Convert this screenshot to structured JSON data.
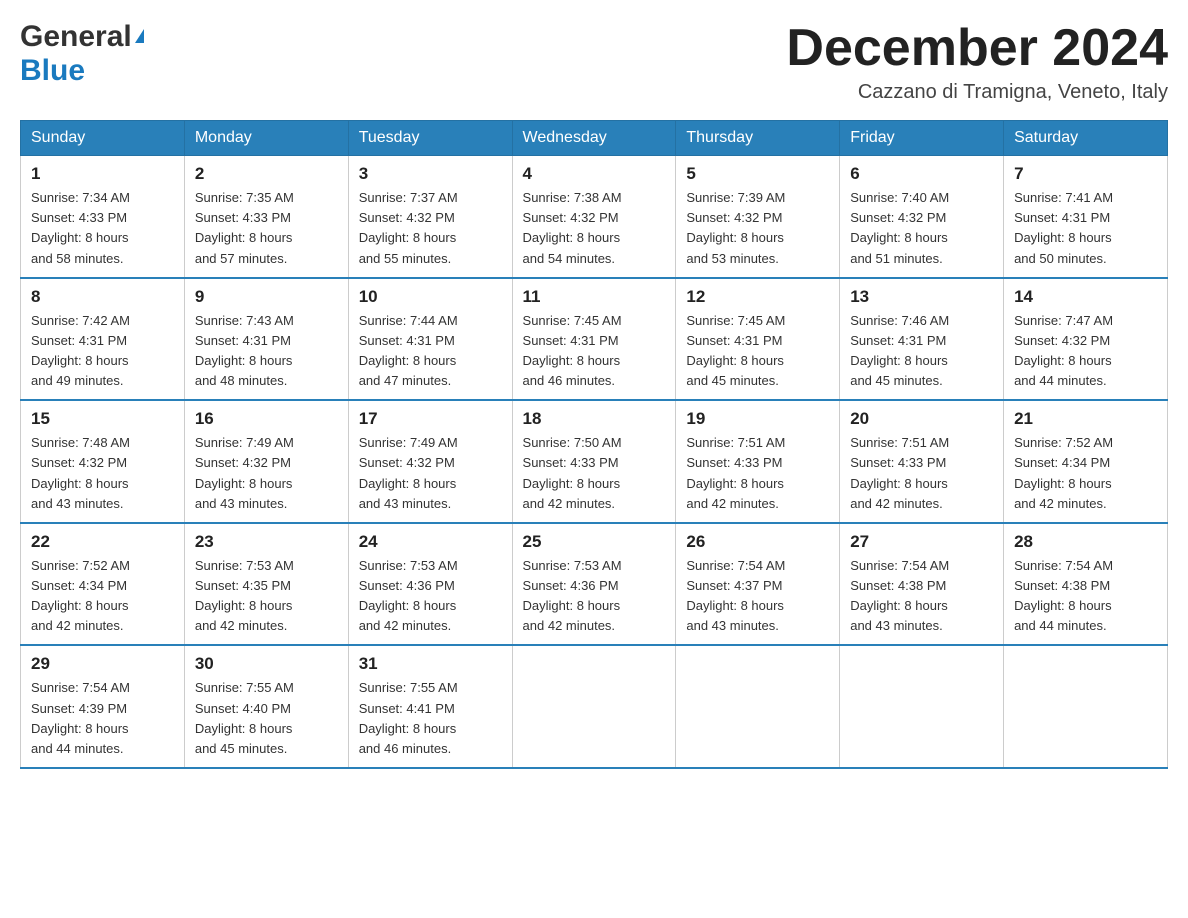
{
  "logo": {
    "general": "General",
    "blue": "Blue"
  },
  "header": {
    "title": "December 2024",
    "location": "Cazzano di Tramigna, Veneto, Italy"
  },
  "days_of_week": [
    "Sunday",
    "Monday",
    "Tuesday",
    "Wednesday",
    "Thursday",
    "Friday",
    "Saturday"
  ],
  "weeks": [
    [
      {
        "day": "1",
        "sunrise": "7:34 AM",
        "sunset": "4:33 PM",
        "daylight": "8 hours and 58 minutes."
      },
      {
        "day": "2",
        "sunrise": "7:35 AM",
        "sunset": "4:33 PM",
        "daylight": "8 hours and 57 minutes."
      },
      {
        "day": "3",
        "sunrise": "7:37 AM",
        "sunset": "4:32 PM",
        "daylight": "8 hours and 55 minutes."
      },
      {
        "day": "4",
        "sunrise": "7:38 AM",
        "sunset": "4:32 PM",
        "daylight": "8 hours and 54 minutes."
      },
      {
        "day": "5",
        "sunrise": "7:39 AM",
        "sunset": "4:32 PM",
        "daylight": "8 hours and 53 minutes."
      },
      {
        "day": "6",
        "sunrise": "7:40 AM",
        "sunset": "4:32 PM",
        "daylight": "8 hours and 51 minutes."
      },
      {
        "day": "7",
        "sunrise": "7:41 AM",
        "sunset": "4:31 PM",
        "daylight": "8 hours and 50 minutes."
      }
    ],
    [
      {
        "day": "8",
        "sunrise": "7:42 AM",
        "sunset": "4:31 PM",
        "daylight": "8 hours and 49 minutes."
      },
      {
        "day": "9",
        "sunrise": "7:43 AM",
        "sunset": "4:31 PM",
        "daylight": "8 hours and 48 minutes."
      },
      {
        "day": "10",
        "sunrise": "7:44 AM",
        "sunset": "4:31 PM",
        "daylight": "8 hours and 47 minutes."
      },
      {
        "day": "11",
        "sunrise": "7:45 AM",
        "sunset": "4:31 PM",
        "daylight": "8 hours and 46 minutes."
      },
      {
        "day": "12",
        "sunrise": "7:45 AM",
        "sunset": "4:31 PM",
        "daylight": "8 hours and 45 minutes."
      },
      {
        "day": "13",
        "sunrise": "7:46 AM",
        "sunset": "4:31 PM",
        "daylight": "8 hours and 45 minutes."
      },
      {
        "day": "14",
        "sunrise": "7:47 AM",
        "sunset": "4:32 PM",
        "daylight": "8 hours and 44 minutes."
      }
    ],
    [
      {
        "day": "15",
        "sunrise": "7:48 AM",
        "sunset": "4:32 PM",
        "daylight": "8 hours and 43 minutes."
      },
      {
        "day": "16",
        "sunrise": "7:49 AM",
        "sunset": "4:32 PM",
        "daylight": "8 hours and 43 minutes."
      },
      {
        "day": "17",
        "sunrise": "7:49 AM",
        "sunset": "4:32 PM",
        "daylight": "8 hours and 43 minutes."
      },
      {
        "day": "18",
        "sunrise": "7:50 AM",
        "sunset": "4:33 PM",
        "daylight": "8 hours and 42 minutes."
      },
      {
        "day": "19",
        "sunrise": "7:51 AM",
        "sunset": "4:33 PM",
        "daylight": "8 hours and 42 minutes."
      },
      {
        "day": "20",
        "sunrise": "7:51 AM",
        "sunset": "4:33 PM",
        "daylight": "8 hours and 42 minutes."
      },
      {
        "day": "21",
        "sunrise": "7:52 AM",
        "sunset": "4:34 PM",
        "daylight": "8 hours and 42 minutes."
      }
    ],
    [
      {
        "day": "22",
        "sunrise": "7:52 AM",
        "sunset": "4:34 PM",
        "daylight": "8 hours and 42 minutes."
      },
      {
        "day": "23",
        "sunrise": "7:53 AM",
        "sunset": "4:35 PM",
        "daylight": "8 hours and 42 minutes."
      },
      {
        "day": "24",
        "sunrise": "7:53 AM",
        "sunset": "4:36 PM",
        "daylight": "8 hours and 42 minutes."
      },
      {
        "day": "25",
        "sunrise": "7:53 AM",
        "sunset": "4:36 PM",
        "daylight": "8 hours and 42 minutes."
      },
      {
        "day": "26",
        "sunrise": "7:54 AM",
        "sunset": "4:37 PM",
        "daylight": "8 hours and 43 minutes."
      },
      {
        "day": "27",
        "sunrise": "7:54 AM",
        "sunset": "4:38 PM",
        "daylight": "8 hours and 43 minutes."
      },
      {
        "day": "28",
        "sunrise": "7:54 AM",
        "sunset": "4:38 PM",
        "daylight": "8 hours and 44 minutes."
      }
    ],
    [
      {
        "day": "29",
        "sunrise": "7:54 AM",
        "sunset": "4:39 PM",
        "daylight": "8 hours and 44 minutes."
      },
      {
        "day": "30",
        "sunrise": "7:55 AM",
        "sunset": "4:40 PM",
        "daylight": "8 hours and 45 minutes."
      },
      {
        "day": "31",
        "sunrise": "7:55 AM",
        "sunset": "4:41 PM",
        "daylight": "8 hours and 46 minutes."
      },
      null,
      null,
      null,
      null
    ]
  ],
  "labels": {
    "sunrise": "Sunrise:",
    "sunset": "Sunset:",
    "daylight": "Daylight:"
  }
}
